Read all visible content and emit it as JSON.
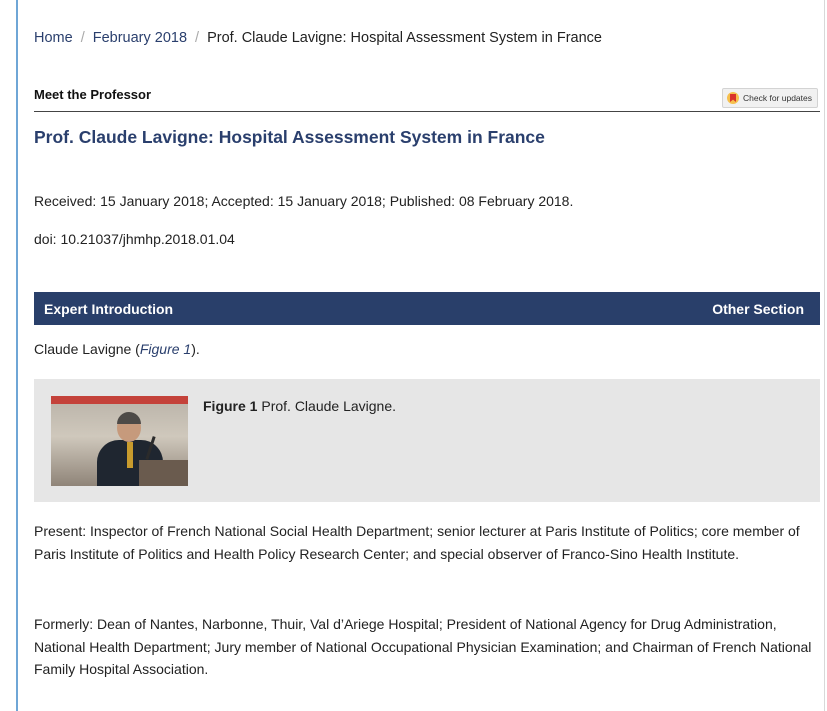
{
  "breadcrumb": {
    "home": "Home",
    "separator": "/",
    "issue": "February 2018",
    "current": "Prof. Claude Lavigne: Hospital Assessment System in France"
  },
  "section": {
    "label": "Meet the Professor",
    "check_updates": "Check for updates"
  },
  "article": {
    "title": "Prof. Claude Lavigne: Hospital Assessment System in France",
    "dates": "Received: 15 January 2018; Accepted: 15 January 2018; Published: 08 February 2018.",
    "doi": "doi: 10.21037/jhmhp.2018.01.04"
  },
  "section_bar": {
    "title": "Expert Introduction",
    "other": "Other Section"
  },
  "intro": {
    "before": "Claude Lavigne (",
    "link": "Figure 1",
    "after": ")."
  },
  "figure": {
    "label": "Figure 1",
    "caption": "Prof. Claude Lavigne."
  },
  "body": {
    "present": "Present: Inspector of French National Social Health Department; senior lecturer at Paris Institute of Politics; core member of Paris Institute of Politics and Health Policy Research Center; and special observer of Franco-Sino Health Institute.",
    "formerly": "Formerly: Dean of Nantes, Narbonne, Thuir, Val d’Ariege Hospital; President of National Agency for Drug Administration, National Health Department; Jury member of National Occupational Physician Examination; and Chairman of French National Family Hospital Association."
  },
  "colors": {
    "accent": "#2a3f6d",
    "bar": "#293f6a",
    "figure_bg": "#e6e6e6",
    "frame_border": "#6fa6d6"
  },
  "icons": {
    "check_updates": "bookmark-badge-icon"
  }
}
